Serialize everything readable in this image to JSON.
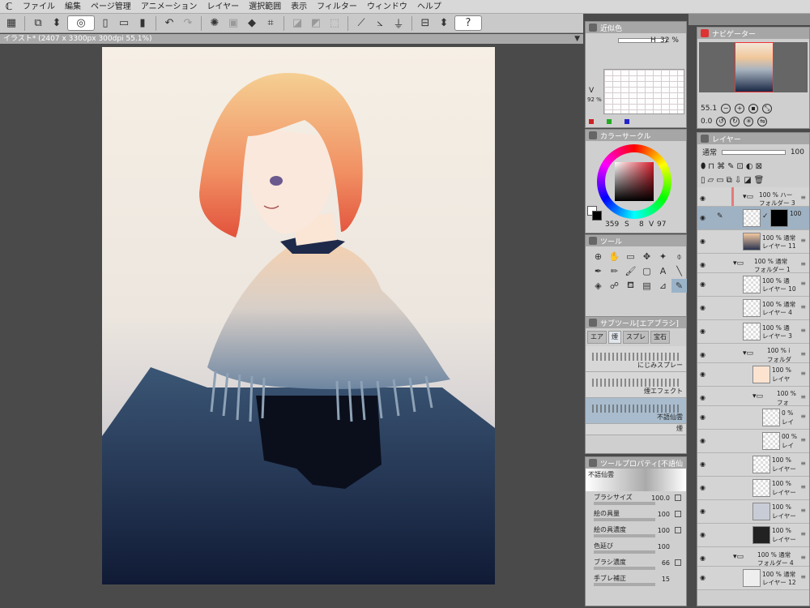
{
  "menu": {
    "logo": "ℂ",
    "items": [
      "ファイル",
      "編集",
      "ページ管理",
      "アニメーション",
      "レイヤー",
      "選択範囲",
      "表示",
      "フィルター",
      "ウィンドウ",
      "ヘルプ"
    ]
  },
  "document": {
    "tab_title": "イラスト* (2407 x 3300px 300dpi 55.1%)",
    "close": "▼"
  },
  "toolbar": {
    "help": "?"
  },
  "near_color": {
    "title": "近似色",
    "h_label": "H",
    "h_value": "32 %",
    "v_label": "V",
    "v_value": "92 %"
  },
  "color_circle": {
    "title": "カラーサークル",
    "h_value": "359",
    "s_label": "S",
    "s_value": "8",
    "v_label": "V",
    "v_value": "97"
  },
  "tool": {
    "title": "ツール"
  },
  "subtool": {
    "title": "サブツール[エアブラシ]",
    "tabs": [
      "エア",
      "煙",
      "スプレ",
      "宝石"
    ],
    "brushes": [
      {
        "name": "にじみスプレー"
      },
      {
        "name": "煙エフェクト"
      },
      {
        "name": "不語仙雲"
      },
      {
        "name": "煙"
      }
    ]
  },
  "tool_property": {
    "title": "ツールプロパティ[不語仙",
    "preview_label": "不語仙雲",
    "props": [
      {
        "label": "ブラシサイズ",
        "value": "100.0"
      },
      {
        "label": "絵の具量",
        "value": "100"
      },
      {
        "label": "絵の具濃度",
        "value": "100"
      },
      {
        "label": "色延び",
        "value": "100"
      },
      {
        "label": "ブラシ濃度",
        "value": "66"
      },
      {
        "label": "手ブレ補正",
        "value": "15"
      }
    ]
  },
  "navigator": {
    "title": "ナビゲーター",
    "zoom": "55.1",
    "rotation": "0.0"
  },
  "layers": {
    "title": "レイヤー",
    "blend_mode": "通常",
    "opacity": "100",
    "rows": [
      {
        "t1": "100 % ハー",
        "t2": "フォルダー 3",
        "folder": true,
        "indent": 0
      },
      {
        "t1": "",
        "t2": "",
        "folder": false,
        "indent": 0,
        "selected": true,
        "side_value": "100"
      },
      {
        "t1": "100 % 通常",
        "t2": "レイヤー 11",
        "folder": false,
        "indent": 0
      },
      {
        "t1": "100 % 通常",
        "t2": "フォルダー 1",
        "folder": true,
        "indent": 0
      },
      {
        "t1": "100 % 通",
        "t2": "レイヤー 10",
        "folder": false,
        "indent": 1
      },
      {
        "t1": "100 % 通常",
        "t2": "レイヤー 4",
        "folder": false,
        "indent": 1
      },
      {
        "t1": "100 % 通",
        "t2": "レイヤー 3",
        "folder": false,
        "indent": 1
      },
      {
        "t1": "100 % i",
        "t2": "フォルダ",
        "folder": true,
        "indent": 1
      },
      {
        "t1": "100 %",
        "t2": "レイヤ",
        "folder": false,
        "indent": 2
      },
      {
        "t1": "100 %",
        "t2": "フォ",
        "folder": true,
        "indent": 2
      },
      {
        "t1": "0 %",
        "t2": "レイ",
        "folder": false,
        "indent": 3
      },
      {
        "t1": "00 %",
        "t2": "レイ",
        "folder": false,
        "indent": 3
      },
      {
        "t1": "100 %",
        "t2": "レイヤー",
        "folder": false,
        "indent": 2
      },
      {
        "t1": "100 %",
        "t2": "レイヤー",
        "folder": false,
        "indent": 2
      },
      {
        "t1": "100 %",
        "t2": "レイヤー",
        "folder": false,
        "indent": 2
      },
      {
        "t1": "100 %",
        "t2": "レイヤー",
        "folder": false,
        "indent": 2
      },
      {
        "t1": "100 % 通常",
        "t2": "フォルダー 4",
        "folder": true,
        "indent": 0
      },
      {
        "t1": "100 % 通常",
        "t2": "レイヤー 12",
        "folder": false,
        "indent": 1
      }
    ]
  }
}
